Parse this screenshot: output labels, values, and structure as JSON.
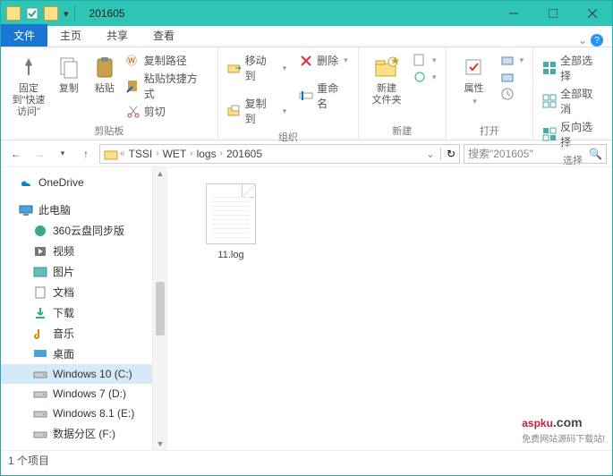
{
  "window": {
    "title": "201605"
  },
  "tabs": {
    "file": "文件",
    "home": "主页",
    "share": "共享",
    "view": "查看"
  },
  "ribbon": {
    "clipboard": {
      "pin": "固定到\"快速访问\"",
      "copy": "复制",
      "paste": "粘贴",
      "cut": "剪切",
      "copypath": "复制路径",
      "pasteshortcut": "粘贴快捷方式",
      "label": "剪贴板"
    },
    "organize": {
      "moveto": "移动到",
      "copyto": "复制到",
      "delete": "删除",
      "rename": "重命名",
      "label": "组织"
    },
    "new": {
      "newfolder": "新建\n文件夹",
      "label": "新建"
    },
    "open": {
      "properties": "属性",
      "label": "打开"
    },
    "select": {
      "selectall": "全部选择",
      "selectnone": "全部取消",
      "invert": "反向选择",
      "label": "选择"
    }
  },
  "breadcrumb": [
    "TSSI",
    "WET",
    "logs",
    "201605"
  ],
  "search": {
    "placeholder": "搜索\"201605\""
  },
  "nav": {
    "onedrive": "OneDrive",
    "thispc": "此电脑",
    "items": [
      {
        "label": "360云盘同步版"
      },
      {
        "label": "视频"
      },
      {
        "label": "图片"
      },
      {
        "label": "文档"
      },
      {
        "label": "下载"
      },
      {
        "label": "音乐"
      },
      {
        "label": "桌面"
      },
      {
        "label": "Windows 10 (C:)",
        "sel": true
      },
      {
        "label": "Windows 7 (D:)"
      },
      {
        "label": "Windows 8.1 (E:)"
      },
      {
        "label": "数据分区 (F:)"
      }
    ]
  },
  "files": [
    {
      "name": "11.log"
    }
  ],
  "status": {
    "count": "1 个项目"
  },
  "watermark": {
    "brand": "aspku",
    "tld": ".com",
    "sub": "免费网站源码下载站!"
  }
}
